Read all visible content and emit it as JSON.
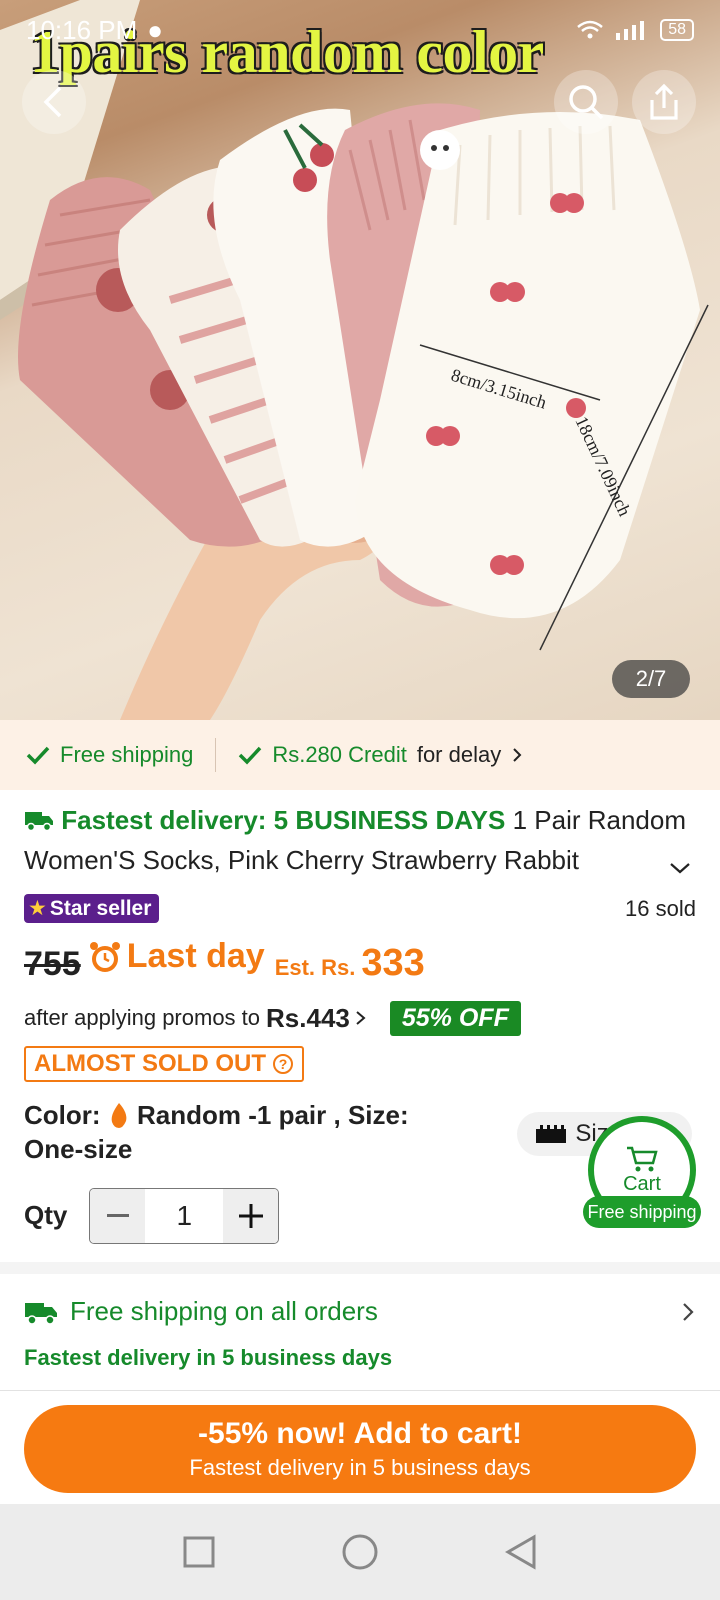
{
  "status_bar": {
    "time": "10:16 PM",
    "battery": "58"
  },
  "hero": {
    "overlay_title": "1pairs random color",
    "measure_width": "8cm/3.15inch",
    "measure_length": "18cm/7.09inch",
    "image_counter": "2/7"
  },
  "perks": {
    "free_shipping": "Free shipping",
    "credit_amount": "Rs.280 Credit",
    "credit_suffix": "for delay"
  },
  "product": {
    "fastest_delivery": "Fastest delivery: 5 BUSINESS DAYS",
    "title": "1 Pair Random Women'S Socks, Pink Cherry Strawberry Rabbit",
    "star_seller": "Star seller",
    "sold_count": "16 sold",
    "original_price": "755",
    "last_day": "Last day",
    "est_label": "Est. Rs.",
    "est_price": "333",
    "promo_prefix": "after applying promos to",
    "promo_price": "Rs.443",
    "discount_badge": "55% OFF",
    "almost_sold_out": "ALMOST SOLD OUT",
    "color_label": "Color:",
    "color_value": "Random -1 pair ,",
    "size_label": "Size:",
    "size_value": "One-size",
    "size_button": "Size",
    "qty_label": "Qty",
    "qty_value": "1"
  },
  "floating_cart": {
    "label": "Cart",
    "badge": "Free shipping"
  },
  "shipping_section": {
    "title": "Free shipping on all orders",
    "subtitle": "Fastest delivery in 5 business days"
  },
  "cta": {
    "main": "-55% now! Add to cart!",
    "sub": "Fastest delivery in 5 business days"
  },
  "colors": {
    "accent_orange": "#f67a11",
    "brand_green": "#168a2b",
    "star_purple": "#5b1f8c",
    "perk_bg": "#fdf1e6"
  },
  "icons": [
    "back-icon",
    "search-icon",
    "share-icon",
    "check-icon",
    "truck-icon",
    "chevron-down-icon",
    "alarm-clock-icon",
    "question-icon",
    "flame-icon",
    "ruler-icon",
    "cart-icon",
    "chevron-right-icon",
    "square-nav-icon",
    "circle-nav-icon",
    "triangle-back-nav-icon"
  ]
}
